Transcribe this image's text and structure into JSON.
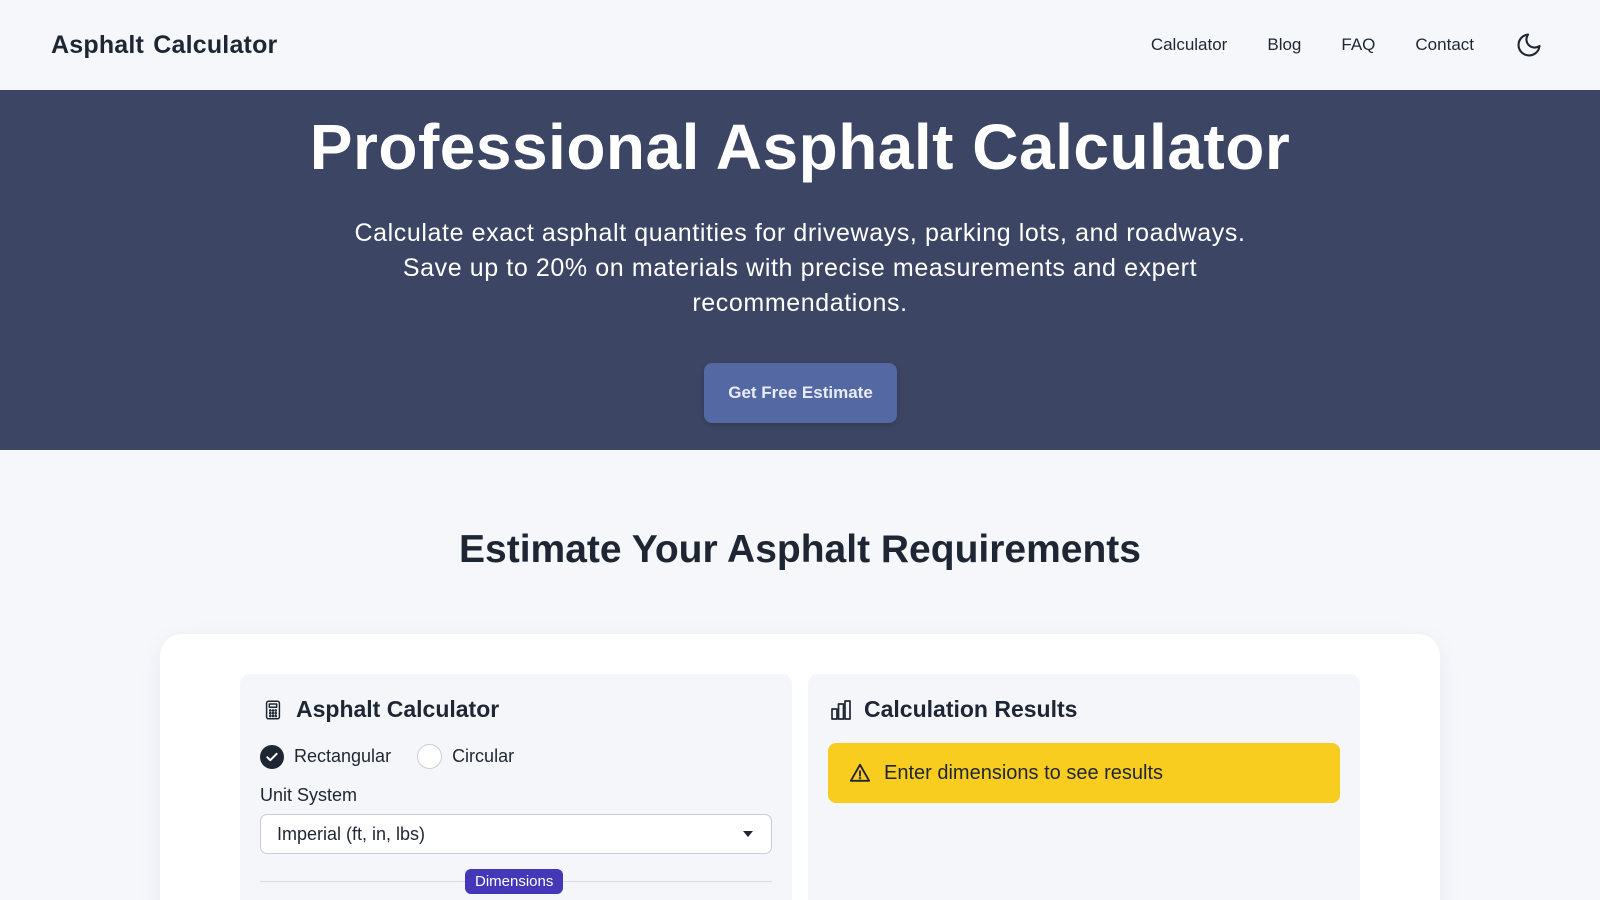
{
  "navbar": {
    "brand": "Asphalt Calculator",
    "links": [
      "Calculator",
      "Blog",
      "FAQ",
      "Contact"
    ],
    "theme_icon": "moon-icon"
  },
  "hero": {
    "title": "Professional Asphalt Calculator",
    "subtitle": "Calculate exact asphalt quantities for driveways, parking lots, and roadways. Save up to 20% on materials with precise measurements and expert recommendations.",
    "cta_label": "Get Free Estimate"
  },
  "section": {
    "title": "Estimate Your Asphalt Requirements"
  },
  "calculator": {
    "title": "Asphalt Calculator",
    "icon": "calculator-icon",
    "shapes": [
      {
        "label": "Rectangular",
        "selected": true
      },
      {
        "label": "Circular",
        "selected": false
      }
    ],
    "unit_label": "Unit System",
    "unit_value": "Imperial (ft, in, lbs)",
    "dimensions_badge": "Dimensions"
  },
  "results": {
    "title": "Calculation Results",
    "icon": "bar-chart-icon",
    "alert_text": "Enter dimensions to see results",
    "alert_icon": "warning-icon"
  },
  "colors": {
    "hero_bg": "#3c4563",
    "cta_bg": "#5468a3",
    "alert_bg": "#f8cd1f",
    "badge_bg": "#4437b8",
    "page_bg": "#f5f7fb"
  }
}
